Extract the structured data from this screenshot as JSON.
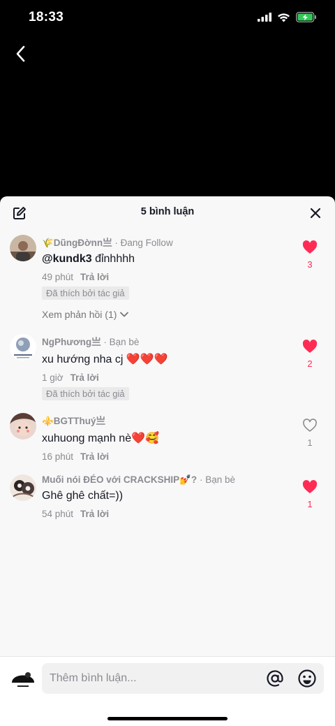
{
  "status_bar": {
    "time": "18:33"
  },
  "sheet": {
    "title": "5 bình luận"
  },
  "comments": [
    {
      "username": "🌾DũngĐờnn亗",
      "relation": "Đang Follow",
      "mention": "@kundk3",
      "text": " đỉnhhhh",
      "time": "49 phút",
      "reply": "Trả lời",
      "badge": "Đã thích bởi tác giả",
      "view_replies": "Xem phản hồi (1)",
      "likes": "3"
    },
    {
      "username": "NgPhương亗",
      "relation": "Bạn bè",
      "text": "xu hướng nha cj ❤️❤️❤️",
      "time": "1 giờ",
      "reply": "Trả lời",
      "badge": "Đã thích bởi tác giả",
      "likes": "2"
    },
    {
      "username": "⚜️BGTThuý亗",
      "text": "xuhuong mạnh nè❤️🥰",
      "time": "16 phút",
      "reply": "Trả lời",
      "likes": "1"
    },
    {
      "username": "Muối nói ĐÉO với CRACKSHIP💅?",
      "relation": "Bạn bè",
      "text": "Ghê ghê chất=))",
      "time": "54 phút",
      "reply": "Trả lời",
      "likes": "1"
    }
  ],
  "composer": {
    "placeholder": "Thêm bình luận..."
  },
  "colors": {
    "like_red": "#fe2c55",
    "sheet_bg": "#f8f8f8",
    "text_gray": "#8a8b91"
  },
  "icons": [
    "back-icon",
    "edit-icon",
    "close-icon",
    "heart-filled-icon",
    "heart-outline-icon",
    "chevron-down-icon",
    "at-icon",
    "emoji-icon",
    "signal-icon",
    "wifi-icon",
    "battery-icon"
  ]
}
